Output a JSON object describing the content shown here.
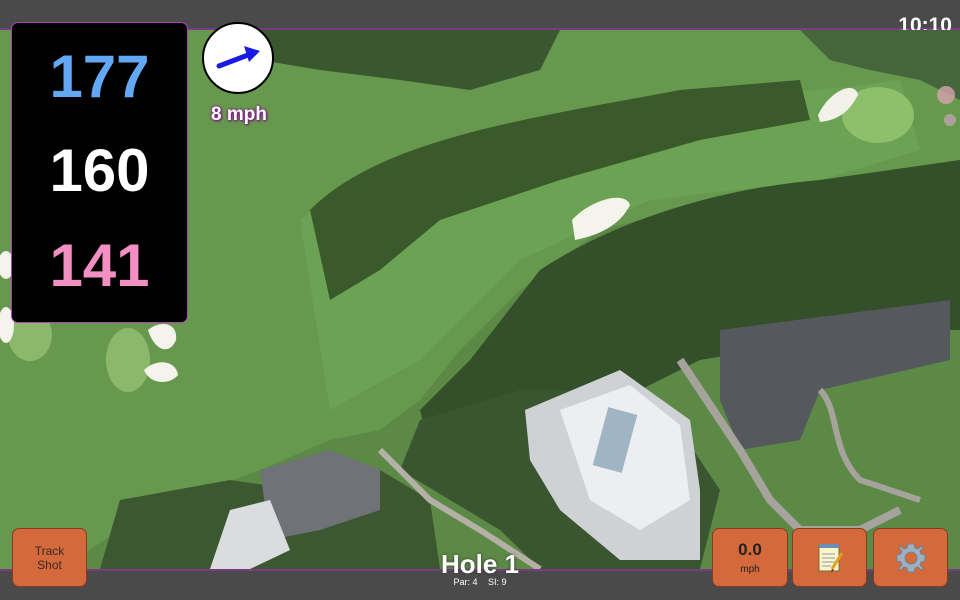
{
  "status": {
    "clock": "10:10"
  },
  "distances": {
    "back": "177",
    "middle": "160",
    "front": "141"
  },
  "wind": {
    "speed_label": "8 mph",
    "arrow_icon": "wind-direction-arrow-icon",
    "arrow_color": "#1a1ae6"
  },
  "hole": {
    "title": "Hole 1",
    "par_label": "Par: 4",
    "si_label": "SI: 9"
  },
  "buttons": {
    "track_line1": "Track",
    "track_line2": "Shot",
    "speed_value": "0.0",
    "speed_unit": "mph",
    "notes_icon": "notepad-icon",
    "settings_icon": "gear-icon"
  },
  "colors": {
    "accent_border": "#b043b7",
    "button_bg": "#d4693b",
    "back_distance": "#62a8f5",
    "front_distance": "#f48fc4"
  }
}
